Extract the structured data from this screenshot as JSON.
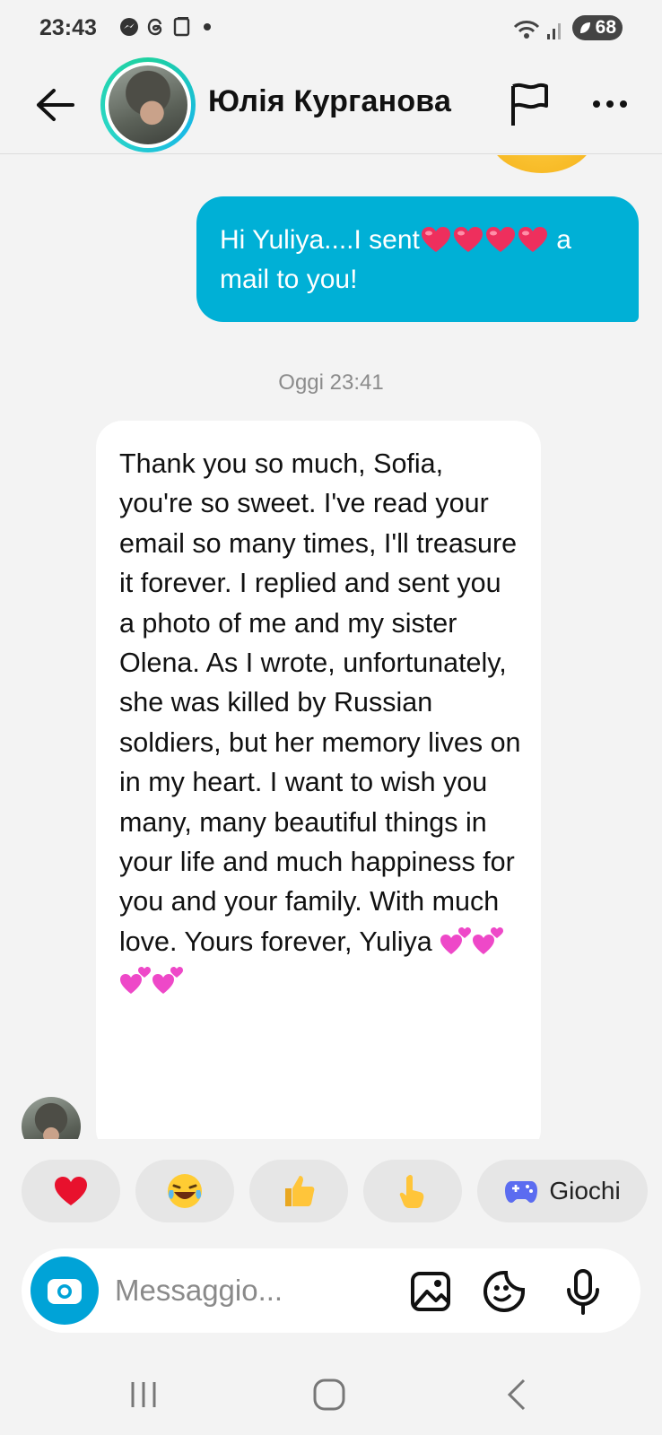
{
  "status_bar": {
    "time": "23:43",
    "battery": "68",
    "icons": [
      "messenger-icon",
      "threads-icon",
      "screenshot-icon",
      "wifi-icon",
      "signal-icon"
    ]
  },
  "header": {
    "contact_name": "Юлія Курганова",
    "icons": [
      "back-arrow-icon",
      "flag-icon",
      "more-icon"
    ]
  },
  "messages": [
    {
      "direction": "outgoing",
      "text_before_hearts": "Hi Yuliya....I sent",
      "hearts": 4,
      "text_after_hearts": " a mail to you!"
    },
    {
      "direction": "divider",
      "timestamp": "Oggi 23:41"
    },
    {
      "direction": "incoming",
      "text": "Thank you so much, Sofia, you're so sweet. I've read your email so many times, I'll treasure it forever. I replied and sent you a photo of me and my sister Olena. As I wrote, unfortunately, she was killed by Russian soldiers, but her memory lives on in my heart. I want to wish you many, many beautiful things in your life and much happiness for you and your family. With much love. Yours forever, Yuliya",
      "trailing_emoji": "💕💕💕💕"
    }
  ],
  "quick_reactions": {
    "items": [
      "❤️",
      "😂",
      "👍",
      "👆"
    ],
    "games_label": "Giochi"
  },
  "composer": {
    "placeholder": "Messaggio...",
    "icons": [
      "camera-icon",
      "gallery-icon",
      "sticker-icon",
      "microphone-icon"
    ]
  },
  "colors": {
    "outgoing_bubble": "#00b0d6",
    "camera_button": "#00a3d7",
    "background": "#f3f3f3"
  }
}
